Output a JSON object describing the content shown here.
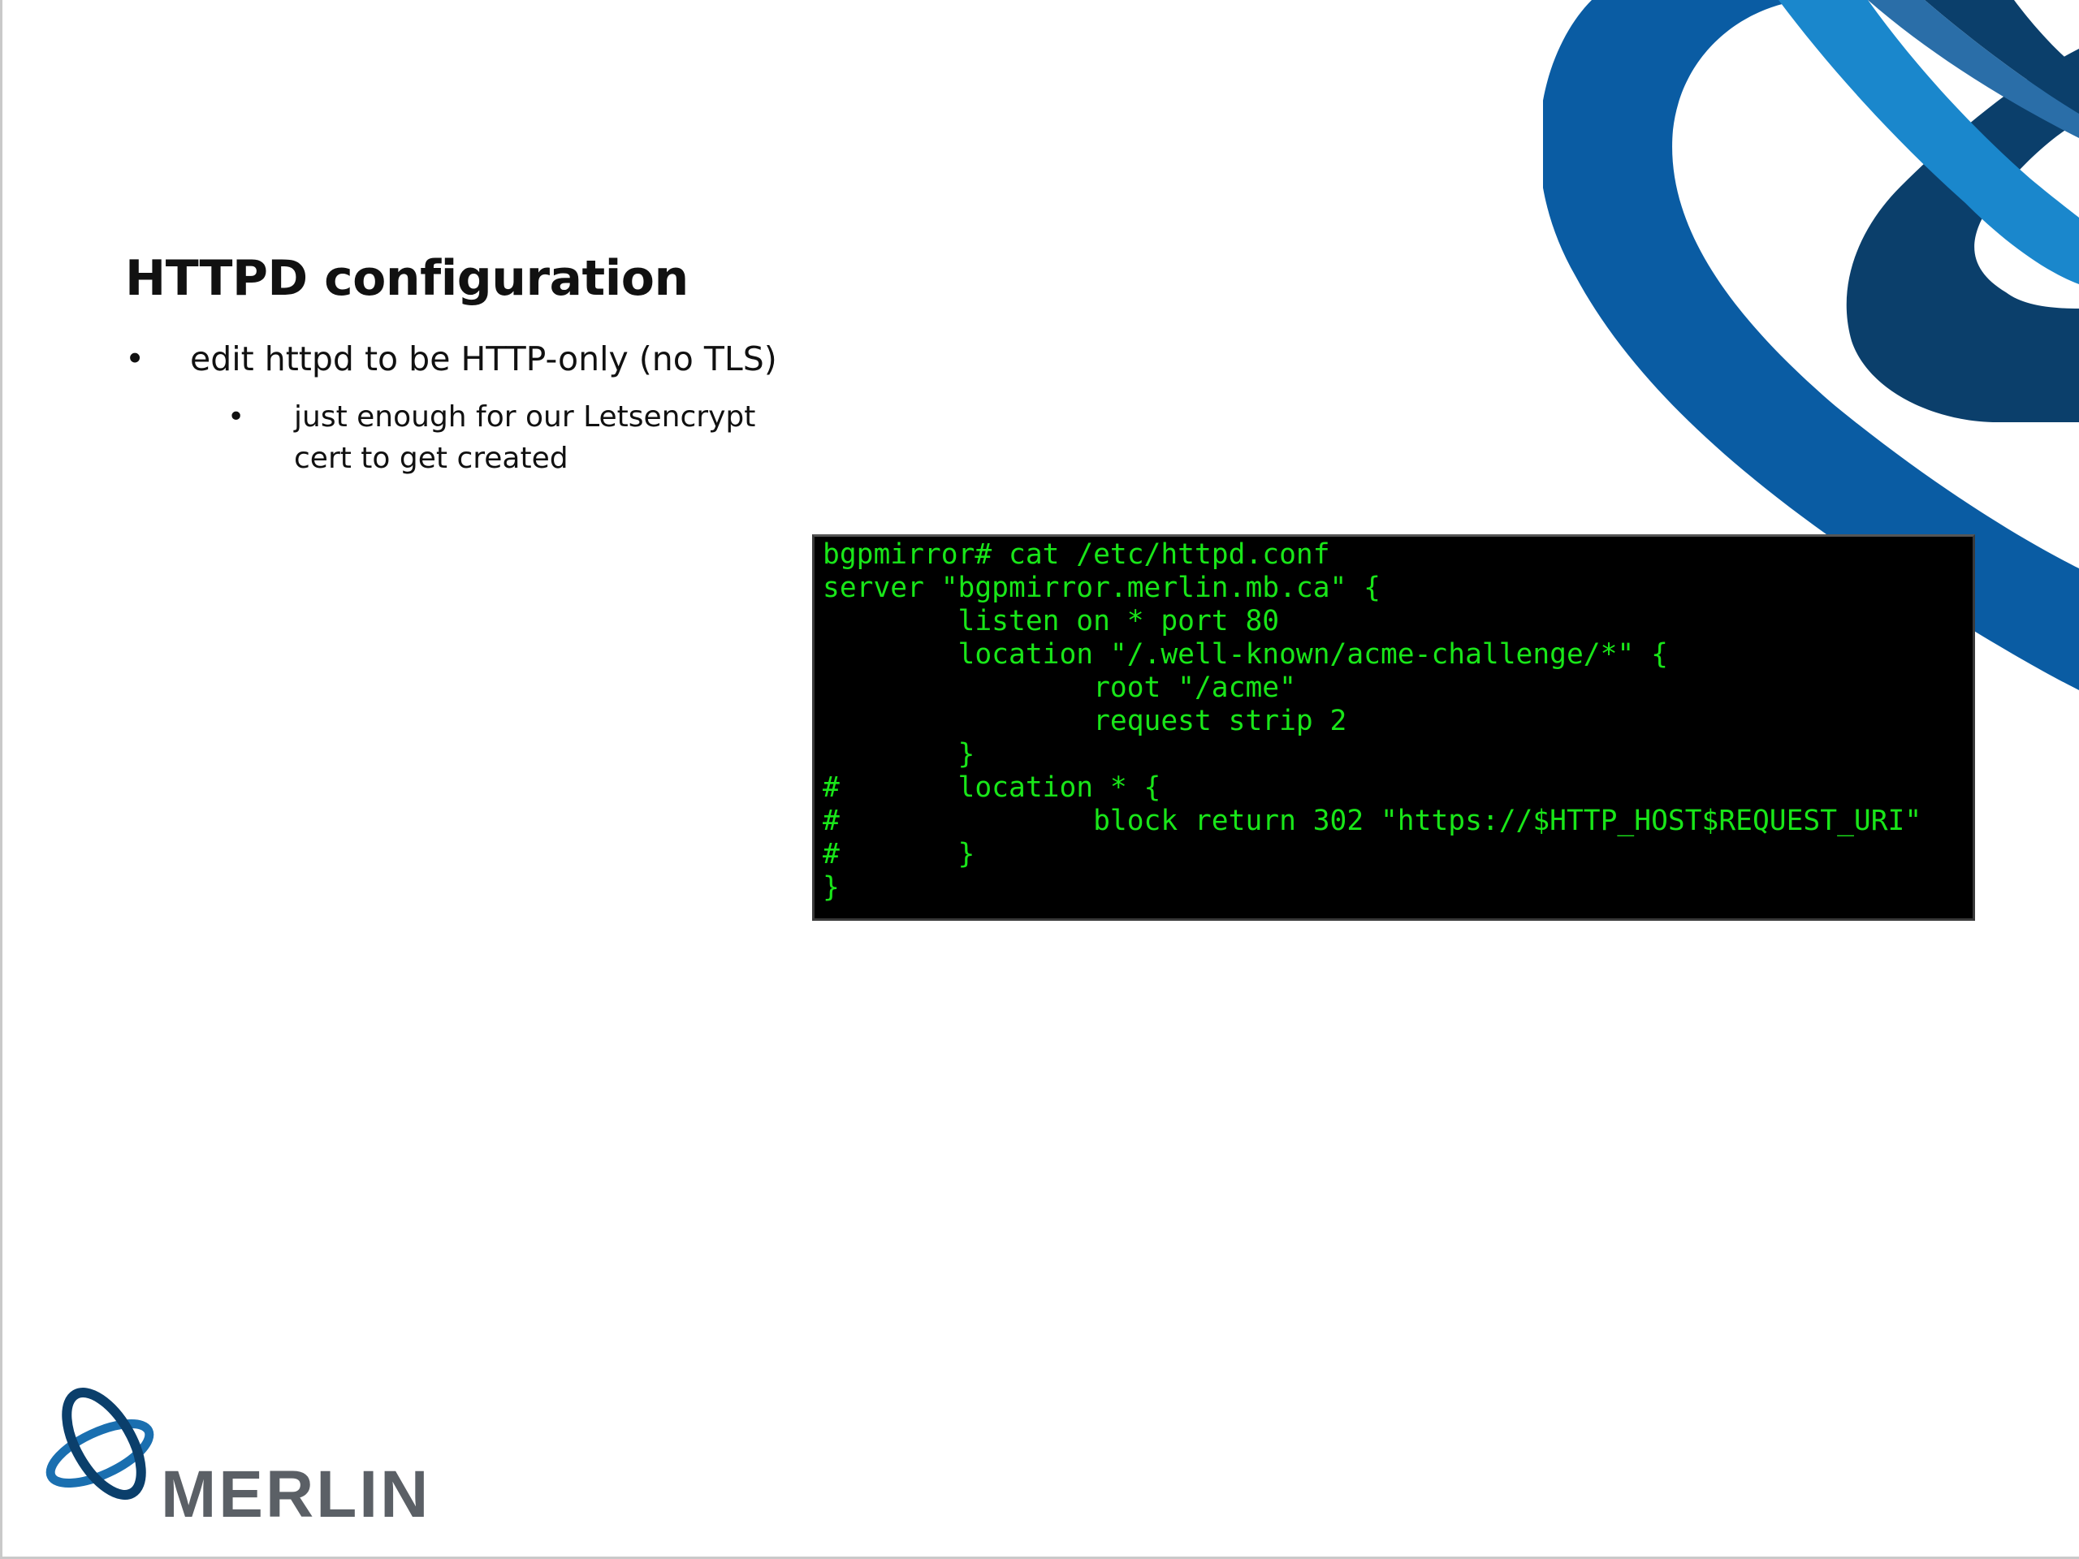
{
  "slide": {
    "title": "HTTPD configuration",
    "bullets": [
      {
        "marker": "•",
        "text": "edit httpd to be HTTP-only (no TLS)"
      }
    ],
    "sub_bullets": [
      {
        "marker": "•",
        "lines": [
          "just enough for our Letsencrypt",
          "cert to get created"
        ]
      }
    ],
    "terminal": {
      "lines": [
        "bgpmirror# cat /etc/httpd.conf",
        "server \"bgpmirror.merlin.mb.ca\" {",
        "        listen on * port 80",
        "        location \"/.well-known/acme-challenge/*\" {",
        "                root \"/acme\"",
        "                request strip 2",
        "        }",
        "#       location * {",
        "#               block return 302 \"https://$HTTP_HOST$REQUEST_URI\"",
        "#       }",
        "}"
      ]
    },
    "logo": {
      "text": "MERLIN"
    },
    "colors": {
      "terminal_text": "#19e619",
      "terminal_bg": "#000000",
      "brand_dark_blue": "#0b3f6b",
      "brand_blue": "#0a5ca3",
      "brand_light_blue": "#1a87cc",
      "logo_gray": "#5b6066"
    }
  }
}
